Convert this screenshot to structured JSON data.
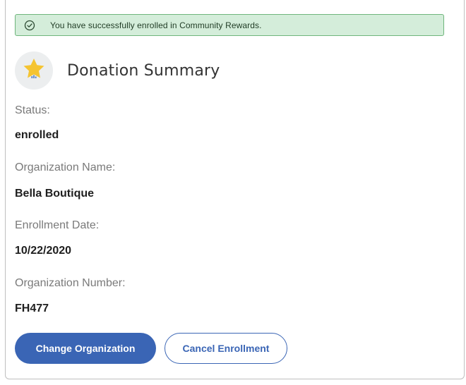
{
  "alert": {
    "message": "You have successfully enrolled in Community Rewards.",
    "icon": "check-circle-icon",
    "color": "#d4edda"
  },
  "header": {
    "title": "Donation Summary",
    "icon": "star-icon"
  },
  "fields": [
    {
      "label": "Status:",
      "value": "enrolled"
    },
    {
      "label": "Organization Name:",
      "value": "Bella Boutique"
    },
    {
      "label": "Enrollment Date:",
      "value": "10/22/2020"
    },
    {
      "label": "Organization Number:",
      "value": "FH477"
    }
  ],
  "actions": {
    "change_label": "Change Organization",
    "cancel_label": "Cancel Enrollment",
    "accent_color": "#3a65b5"
  }
}
